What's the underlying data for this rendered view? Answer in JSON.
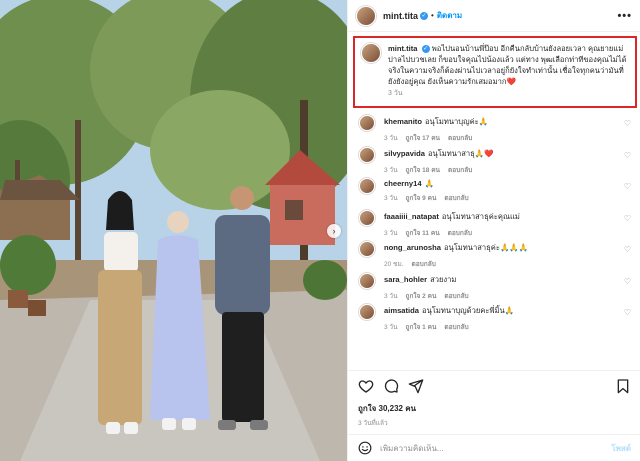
{
  "post": {
    "username": "mint.tita",
    "follow_label": "ติดตาม",
    "more_label": "•••"
  },
  "caption": {
    "username": "mint.tita",
    "text": "พอไปนอนบ้านพี่ป๊อบ อีกคืนกลับบ้านยังลอยเวลา คุณยายแม่ปาลไปบวชเลย ก็ขอบใจคุณไปน้องแล้ว แต่ทาง พุฒเลือกท่าทีของคุณไม่ได้จริงในความจริงก็ต้องผ่านไปเวลาอยู่ก็ยังใจทำเท่านั้น เชื่อใจทุกคนว่ามันที่ยังยังอยู่คุณ ยังเห็นความรักเสมอมาก❤️",
    "time": "3 วัน"
  },
  "comments": [
    {
      "username": "khemanito",
      "text": "อนุโมทนาบุญค่ะ🙏",
      "time": "3 วัน",
      "likes": "ถูกใจ 17 คน",
      "reply": "ตอบกลับ"
    },
    {
      "username": "silvypavida",
      "text": "อนุโมทนาสาธุ🙏❤️",
      "time": "3 วัน",
      "likes": "ถูกใจ 18 คน",
      "reply": "ตอบกลับ"
    },
    {
      "username": "cheerny14",
      "text": "🙏",
      "time": "3 วัน",
      "likes": "ถูกใจ 9 คน",
      "reply": "ตอบกลับ"
    },
    {
      "username": "faaaiiii_natapat",
      "text": "อนุโมทนาสาธุค่ะคุณแม่",
      "time": "3 วัน",
      "likes": "ถูกใจ 11 คน",
      "reply": "ตอบกลับ"
    },
    {
      "username": "nong_arunosha",
      "text": "อนุโมทนาสาธุค่ะ🙏🙏🙏",
      "time": "20 ชม.",
      "likes": "",
      "reply": "ตอบกลับ"
    },
    {
      "username": "sara_hohler",
      "text": "สวยงาม",
      "time": "3 วัน",
      "likes": "ถูกใจ 2 คน",
      "reply": "ตอบกลับ"
    },
    {
      "username": "aimsatida",
      "text": "อนุโมทนาบุญด้วยคะพี่มิ้น🙏",
      "time": "3 วัน",
      "likes": "ถูกใจ 1 คน",
      "reply": "ตอบกลับ"
    }
  ],
  "engagement": {
    "likes": "ถูกใจ 30,232 คน",
    "date": "3 วันที่แล้ว"
  },
  "add_comment": {
    "placeholder": "เพิ่มความคิดเห็น...",
    "post_label": "โพสต์"
  },
  "icons": {
    "heart": "heart-icon",
    "comment": "comment-icon",
    "share": "share-icon",
    "save": "bookmark-icon",
    "emoji": "emoji-icon",
    "next": "chevron-right-icon"
  },
  "colors": {
    "accent_blue": "#0095f6",
    "verified_blue": "#3897f0",
    "highlight_red": "#d9282a",
    "muted_text": "#8e8e8e"
  }
}
